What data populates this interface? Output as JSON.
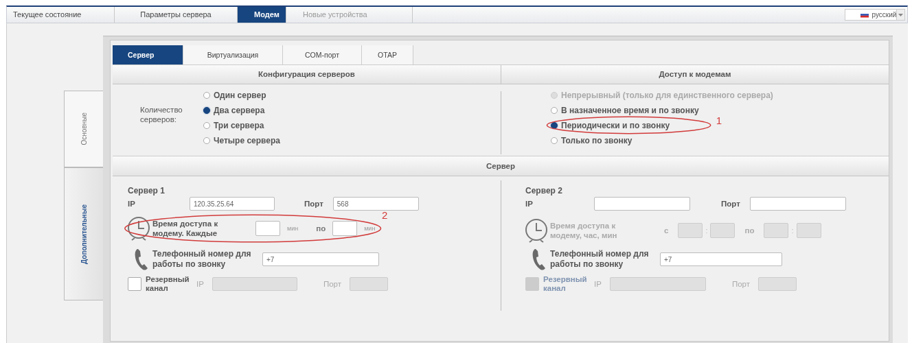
{
  "top_tabs": [
    {
      "label": "Текущее состояние",
      "selected": false,
      "disabled": false
    },
    {
      "label": "Параметры сервера",
      "selected": false,
      "disabled": false
    },
    {
      "label": "Модем",
      "selected": true,
      "disabled": false
    },
    {
      "label": "Новые устройства",
      "selected": false,
      "disabled": true
    }
  ],
  "language": {
    "value": "русский"
  },
  "side_tabs": [
    {
      "label": "Основные",
      "selected": false
    },
    {
      "label": "Дополнительные",
      "selected": true
    }
  ],
  "inner_tabs": [
    {
      "label": "Сервер",
      "selected": true
    },
    {
      "label": "Виртуализация",
      "selected": false
    },
    {
      "label": "COM-порт",
      "selected": false
    },
    {
      "label": "OTAP",
      "selected": false
    }
  ],
  "server_config": {
    "header": "Конфигурация серверов",
    "label": "Количество серверов:",
    "options": [
      {
        "label": "Один сервер",
        "selected": false,
        "disabled": false
      },
      {
        "label": "Два сервера",
        "selected": true,
        "disabled": false
      },
      {
        "label": "Три сервера",
        "selected": false,
        "disabled": false
      },
      {
        "label": "Четыре сервера",
        "selected": false,
        "disabled": false
      }
    ]
  },
  "modem_access": {
    "header": "Доступ к модемам",
    "options": [
      {
        "label": "Непрерывный (только для единственного сервера)",
        "selected": false,
        "disabled": true
      },
      {
        "label": "В назначенное время и по звонку",
        "selected": false,
        "disabled": false
      },
      {
        "label": "Периодически и по звонку",
        "selected": true,
        "disabled": false,
        "mark": "1"
      },
      {
        "label": "Только по звонку",
        "selected": false,
        "disabled": false
      }
    ]
  },
  "server_header": "Сервер",
  "servers": [
    {
      "title": "Сервер 1",
      "ip_label": "IP",
      "ip": "120.35.25.64",
      "port_label": "Порт",
      "port": "568",
      "time": {
        "label": "Время доступа к модему. Каждые",
        "disabled": false,
        "mark": "2",
        "parts": [
          {
            "kind": "field"
          },
          {
            "kind": "unit",
            "text": "мин"
          },
          {
            "kind": "text",
            "text": "по"
          },
          {
            "kind": "field"
          },
          {
            "kind": "unit",
            "text": "мин"
          }
        ]
      },
      "phone_label": "Телефонный номер для работы по звонку",
      "phone": "+7",
      "backup": {
        "label": "Резервный канал",
        "checked": false,
        "disabled": false,
        "ip_label": "IP",
        "port_label": "Порт"
      }
    },
    {
      "title": "Сервер 2",
      "ip_label": "IP",
      "port_label": "Порт",
      "time": {
        "label": "Время доступа к модему, час, мин",
        "disabled": true,
        "parts": [
          {
            "kind": "text",
            "text": "с"
          },
          {
            "kind": "field"
          },
          {
            "kind": "sep",
            "text": ":"
          },
          {
            "kind": "field"
          },
          {
            "kind": "text",
            "text": "по"
          },
          {
            "kind": "field"
          },
          {
            "kind": "sep",
            "text": ":"
          },
          {
            "kind": "field"
          }
        ]
      },
      "phone_label": "Телефонный номер для работы по звонку",
      "phone": "+7",
      "backup": {
        "label": "Резервный канал",
        "checked": false,
        "disabled": true,
        "ip_label": "IP",
        "port_label": "Порт"
      }
    }
  ]
}
